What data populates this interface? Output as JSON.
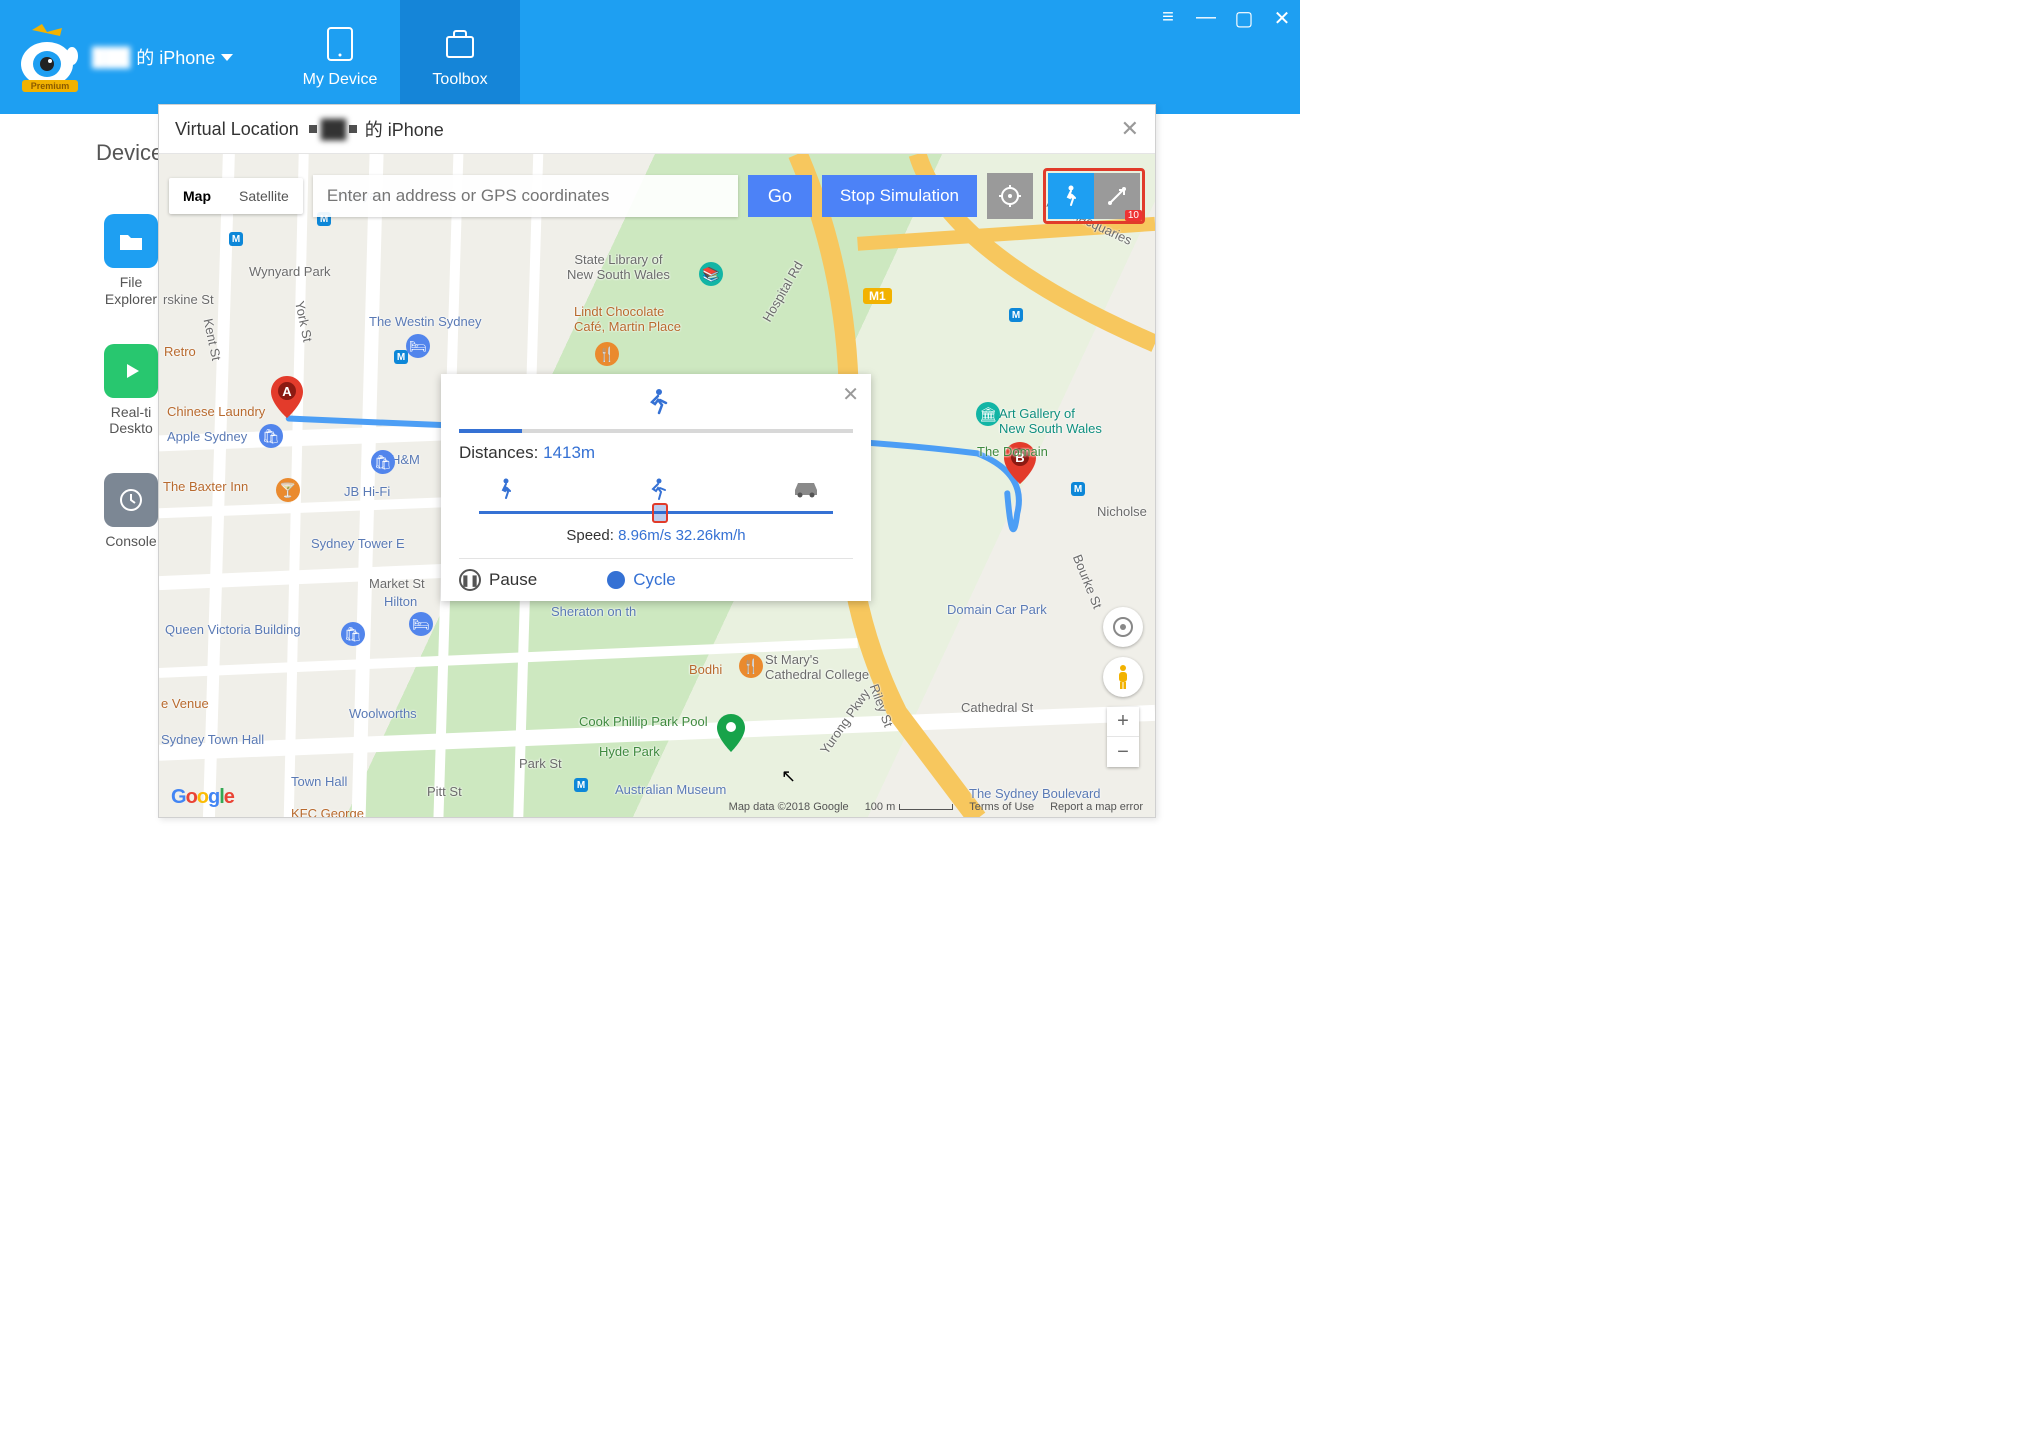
{
  "titlebar": {
    "device_blur": "███",
    "device_suffix": "的 iPhone",
    "premium_badge": "Premium"
  },
  "nav": {
    "my_device": "My Device",
    "toolbox": "Toolbox"
  },
  "content": {
    "heading": "Device",
    "tools": {
      "file_explorer": "File\nExplorer",
      "realtime_desktop": "Real-ti\nDeskto",
      "console": "Console"
    }
  },
  "vl": {
    "title_prefix": "Virtual Location",
    "title_device_blur": "██",
    "title_device_suffix": "的 iPhone",
    "map_type": {
      "map": "Map",
      "satellite": "Satellite"
    },
    "search": {
      "placeholder": "Enter an address or GPS coordinates"
    },
    "go": "Go",
    "stop": "Stop Simulation",
    "highlight_badge": "10",
    "markers": {
      "a": "A",
      "b": "B"
    },
    "footer": {
      "attribution": "Map data ©2018 Google",
      "scale": "100 m",
      "terms": "Terms of Use",
      "report": "Report a map error"
    }
  },
  "sim": {
    "distances_label": "Distances:",
    "distances_value": "1413m",
    "progress_pct": 16,
    "speed_label": "Speed:",
    "speed_value": "8.96m/s 32.26km/h",
    "slider_pct": 50,
    "pause": "Pause",
    "cycle": "Cycle"
  },
  "map_labels": {
    "wynyard": "Wynyard",
    "wynyard_park": "Wynyard Park",
    "state_library": "State Library of\nNew South Wales",
    "westin": "The Westin Sydney",
    "lindt": "Lindt Chocolate\nCafé, Martin Place",
    "m1": "M1",
    "retro": "Retro",
    "chinese_laundry": "Chinese Laundry",
    "apple_sydney": "Apple Sydney",
    "hm": "H&M",
    "baxter": "The Baxter Inn",
    "jbhifi": "JB Hi-Fi",
    "sydney_tower": "Sydney Tower E",
    "market_st": "Market St",
    "hilton": "Hilton",
    "qvb": "Queen Victoria Building",
    "sheraton": "Sheraton on th",
    "art_gallery": "Art Gallery of\nNew South Wales",
    "domain": "The Domain",
    "domain_carpark": "Domain Car Park",
    "st_marys": "St Mary's\nCathedral College",
    "bodhi": "Bodhi",
    "cathedral_st": "Cathedral St",
    "nicholson": "Nicholse",
    "bourke": "Bourke St",
    "riley": "Riley St",
    "yurong": "Yurong Pkwy",
    "cook_phillip": "Cook Phillip Park Pool",
    "hyde_park": "Hyde Park",
    "park_st": "Park St",
    "aus_museum": "Australian Museum",
    "woolworths": "Woolworths",
    "venue": "e Venue",
    "townhall_station": "Sydney Town Hall",
    "town_hall_poi": "Town Hall",
    "pitt_st": "Pitt St",
    "sydney_blvd": "The Sydney Boulevard",
    "erskine": "rskine St",
    "kent": "Kent St",
    "york": "York St",
    "hospital_rd": "Hospital Rd",
    "mrs_macq": "Mrs Macquaries",
    "kfc": "KFC George"
  }
}
